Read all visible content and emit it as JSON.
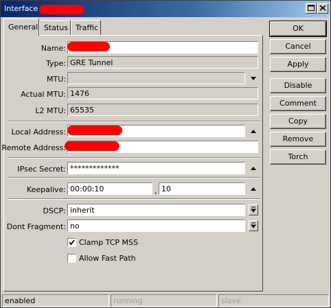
{
  "window": {
    "title": "Interface <",
    "buttons": {
      "maximize_icon": "maximize-icon",
      "close_icon": "close-icon"
    }
  },
  "tabs": [
    {
      "label": "General",
      "active": true
    },
    {
      "label": "Status",
      "active": false
    },
    {
      "label": "Traffic",
      "active": false
    }
  ],
  "form": {
    "name": {
      "label": "Name:",
      "value": ""
    },
    "type": {
      "label": "Type:",
      "value": "GRE Tunnel"
    },
    "mtu": {
      "label": "MTU:",
      "value": ""
    },
    "actual_mtu": {
      "label": "Actual MTU:",
      "value": "1476"
    },
    "l2_mtu": {
      "label": "L2 MTU:",
      "value": "65535"
    },
    "local_address": {
      "label": "Local Address:",
      "value": ""
    },
    "remote_address": {
      "label": "Remote Address:",
      "value": ""
    },
    "ipsec_secret": {
      "label": "IPsec Secret:",
      "value": "*************"
    },
    "keepalive": {
      "label": "Keepalive:",
      "interval": "00:00:10",
      "separator": ",",
      "retries": "10"
    },
    "dscp": {
      "label": "DSCP:",
      "value": "inherit"
    },
    "dont_fragment": {
      "label": "Dont Fragment:",
      "value": "no"
    },
    "clamp_tcp_mss": {
      "label": "Clamp TCP MSS",
      "checked": true
    },
    "allow_fast_path": {
      "label": "Allow Fast Path",
      "checked": false
    }
  },
  "actions": [
    {
      "label": "OK",
      "name": "ok-button"
    },
    {
      "label": "Cancel",
      "name": "cancel-button"
    },
    {
      "label": "Apply",
      "name": "apply-button"
    },
    {
      "label": "Disable",
      "name": "disable-button"
    },
    {
      "label": "Comment",
      "name": "comment-button"
    },
    {
      "label": "Copy",
      "name": "copy-button"
    },
    {
      "label": "Remove",
      "name": "remove-button"
    },
    {
      "label": "Torch",
      "name": "torch-button"
    }
  ],
  "status_bar": {
    "state": "enabled",
    "running": "running",
    "slave": "slave"
  },
  "colors": {
    "redaction": "#ff0000",
    "titlebar": "#0a246a",
    "face": "#d4d0c8"
  }
}
